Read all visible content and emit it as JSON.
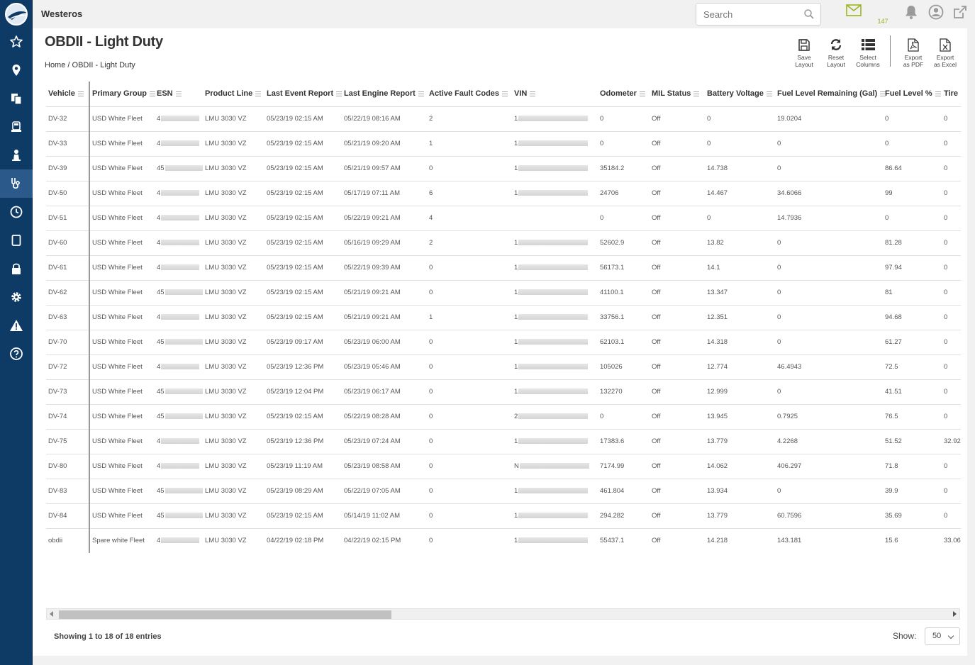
{
  "app": {
    "org_name": "Westeros",
    "search_placeholder": "Search",
    "mail_count": "147"
  },
  "page": {
    "title": "OBDII - Light Duty",
    "breadcrumb_home": "Home",
    "breadcrumb_sep": "/",
    "breadcrumb_current": "OBDII - Light Duty"
  },
  "toolbar": {
    "save_layout": [
      "Save",
      "Layout"
    ],
    "reset_layout": [
      "Reset",
      "Layout"
    ],
    "select_columns": [
      "Select",
      "Columns"
    ],
    "export_pdf": [
      "Export",
      "as PDF"
    ],
    "export_excel": [
      "Export",
      "as Excel"
    ]
  },
  "table": {
    "columns": [
      "Vehicle",
      "Primary Group",
      "ESN",
      "Product Line",
      "Last Event Report",
      "Last Engine Report",
      "Active Fault Codes",
      "VIN",
      "Odometer",
      "MIL Status",
      "Battery Voltage",
      "Fuel Level Remaining (Gal)",
      "Fuel Level %",
      "Tire"
    ],
    "rows": [
      {
        "vehicle": "DV-32",
        "group": "USD White Fleet",
        "esn": "4",
        "product": "LMU 3030 VZ",
        "last_event": "05/23/19 02:15 AM",
        "last_engine": "05/22/19 08:16 AM",
        "faults": "2",
        "vin": "1",
        "odometer": "0",
        "mil": "Off",
        "battery": "0",
        "fuel_gal": "19.0204",
        "fuel_pct": "0",
        "tire": "0"
      },
      {
        "vehicle": "DV-33",
        "group": "USD White Fleet",
        "esn": "4",
        "product": "LMU 3030 VZ",
        "last_event": "05/23/19 02:15 AM",
        "last_engine": "05/21/19 09:20 AM",
        "faults": "1",
        "vin": "1",
        "odometer": "0",
        "mil": "Off",
        "battery": "0",
        "fuel_gal": "0",
        "fuel_pct": "0",
        "tire": "0"
      },
      {
        "vehicle": "DV-39",
        "group": "USD White Fleet",
        "esn": "45",
        "product": "LMU 3030 VZ",
        "last_event": "05/23/19 02:15 AM",
        "last_engine": "05/21/19 09:57 AM",
        "faults": "0",
        "vin": "1",
        "odometer": "35184.2",
        "mil": "Off",
        "battery": "14.738",
        "fuel_gal": "0",
        "fuel_pct": "86.64",
        "tire": "0"
      },
      {
        "vehicle": "DV-50",
        "group": "USD White Fleet",
        "esn": "4",
        "product": "LMU 3030 VZ",
        "last_event": "05/23/19 02:15 AM",
        "last_engine": "05/17/19 07:11 AM",
        "faults": "6",
        "vin": "1",
        "odometer": "24706",
        "mil": "Off",
        "battery": "14.467",
        "fuel_gal": "34.6066",
        "fuel_pct": "99",
        "tire": "0"
      },
      {
        "vehicle": "DV-51",
        "group": "USD White Fleet",
        "esn": "4",
        "product": "LMU 3030 VZ",
        "last_event": "05/23/19 02:15 AM",
        "last_engine": "05/22/19 09:21 AM",
        "faults": "4",
        "vin": "",
        "odometer": "0",
        "mil": "Off",
        "battery": "0",
        "fuel_gal": "14.7936",
        "fuel_pct": "0",
        "tire": "0"
      },
      {
        "vehicle": "DV-60",
        "group": "USD White Fleet",
        "esn": "4",
        "product": "LMU 3030 VZ",
        "last_event": "05/23/19 02:15 AM",
        "last_engine": "05/16/19 09:29 AM",
        "faults": "2",
        "vin": "1",
        "odometer": "52602.9",
        "mil": "Off",
        "battery": "13.82",
        "fuel_gal": "0",
        "fuel_pct": "81.28",
        "tire": "0"
      },
      {
        "vehicle": "DV-61",
        "group": "USD White Fleet",
        "esn": "4",
        "product": "LMU 3030 VZ",
        "last_event": "05/23/19 02:15 AM",
        "last_engine": "05/22/19 09:39 AM",
        "faults": "0",
        "vin": "1",
        "odometer": "56173.1",
        "mil": "Off",
        "battery": "14.1",
        "fuel_gal": "0",
        "fuel_pct": "97.94",
        "tire": "0"
      },
      {
        "vehicle": "DV-62",
        "group": "USD White Fleet",
        "esn": "45",
        "product": "LMU 3030 VZ",
        "last_event": "05/23/19 02:15 AM",
        "last_engine": "05/21/19 09:21 AM",
        "faults": "0",
        "vin": "1",
        "odometer": "41100.1",
        "mil": "Off",
        "battery": "13.347",
        "fuel_gal": "0",
        "fuel_pct": "81",
        "tire": "0"
      },
      {
        "vehicle": "DV-63",
        "group": "USD White Fleet",
        "esn": "4",
        "product": "LMU 3030 VZ",
        "last_event": "05/23/19 02:15 AM",
        "last_engine": "05/21/19 09:21 AM",
        "faults": "1",
        "vin": "1",
        "odometer": "33756.1",
        "mil": "Off",
        "battery": "12.351",
        "fuel_gal": "0",
        "fuel_pct": "94.68",
        "tire": "0"
      },
      {
        "vehicle": "DV-70",
        "group": "USD White Fleet",
        "esn": "45",
        "product": "LMU 3030 VZ",
        "last_event": "05/23/19 09:17 AM",
        "last_engine": "05/23/19 06:00 AM",
        "faults": "0",
        "vin": "1",
        "odometer": "62103.1",
        "mil": "Off",
        "battery": "14.318",
        "fuel_gal": "0",
        "fuel_pct": "61.27",
        "tire": "0"
      },
      {
        "vehicle": "DV-72",
        "group": "USD White Fleet",
        "esn": "4",
        "product": "LMU 3030 VZ",
        "last_event": "05/23/19 12:36 PM",
        "last_engine": "05/23/19 05:46 AM",
        "faults": "0",
        "vin": "1",
        "odometer": "105026",
        "mil": "Off",
        "battery": "12.774",
        "fuel_gal": "46.4943",
        "fuel_pct": "72.5",
        "tire": "0"
      },
      {
        "vehicle": "DV-73",
        "group": "USD White Fleet",
        "esn": "45",
        "product": "LMU 3030 VZ",
        "last_event": "05/23/19 12:04 PM",
        "last_engine": "05/23/19 06:17 AM",
        "faults": "0",
        "vin": "1",
        "odometer": "132270",
        "mil": "Off",
        "battery": "12.999",
        "fuel_gal": "0",
        "fuel_pct": "41.51",
        "tire": "0"
      },
      {
        "vehicle": "DV-74",
        "group": "USD White Fleet",
        "esn": "45",
        "product": "LMU 3030 VZ",
        "last_event": "05/23/19 02:15 AM",
        "last_engine": "05/22/19 08:28 AM",
        "faults": "0",
        "vin": "2",
        "odometer": "0",
        "mil": "Off",
        "battery": "13.945",
        "fuel_gal": "0.7925",
        "fuel_pct": "76.5",
        "tire": "0"
      },
      {
        "vehicle": "DV-75",
        "group": "USD White Fleet",
        "esn": "4",
        "product": "LMU 3030 VZ",
        "last_event": "05/23/19 12:36 PM",
        "last_engine": "05/23/19 07:24 AM",
        "faults": "0",
        "vin": "1",
        "odometer": "17383.6",
        "mil": "Off",
        "battery": "13.779",
        "fuel_gal": "4.2268",
        "fuel_pct": "51.52",
        "tire": "32.92"
      },
      {
        "vehicle": "DV-80",
        "group": "USD White Fleet",
        "esn": "4",
        "product": "LMU 3030 VZ",
        "last_event": "05/23/19 11:19 AM",
        "last_engine": "05/23/19 08:58 AM",
        "faults": "0",
        "vin": "N",
        "odometer": "7174.99",
        "mil": "Off",
        "battery": "14.062",
        "fuel_gal": "406.297",
        "fuel_pct": "71.8",
        "tire": "0"
      },
      {
        "vehicle": "DV-83",
        "group": "USD White Fleet",
        "esn": "45",
        "product": "LMU 3030 VZ",
        "last_event": "05/23/19 08:29 AM",
        "last_engine": "05/22/19 07:05 AM",
        "faults": "0",
        "vin": "1",
        "odometer": "461.804",
        "mil": "Off",
        "battery": "13.934",
        "fuel_gal": "0",
        "fuel_pct": "39.9",
        "tire": "0"
      },
      {
        "vehicle": "DV-84",
        "group": "USD White Fleet",
        "esn": "45",
        "product": "LMU 3030 VZ",
        "last_event": "05/23/19 02:15 AM",
        "last_engine": "05/14/19 11:02 AM",
        "faults": "0",
        "vin": "1",
        "odometer": "294.282",
        "mil": "Off",
        "battery": "13.779",
        "fuel_gal": "60.7596",
        "fuel_pct": "35.69",
        "tire": "0"
      },
      {
        "vehicle": "obdii",
        "group": "Spare white Fleet",
        "esn": "4",
        "product": "LMU 3030 VZ",
        "last_event": "04/22/19 02:18 PM",
        "last_engine": "04/22/19 02:15 PM",
        "faults": "0",
        "vin": "1",
        "odometer": "55437.1",
        "mil": "Off",
        "battery": "14.218",
        "fuel_gal": "143.181",
        "fuel_pct": "15.6",
        "tire": "33.06"
      }
    ]
  },
  "footer": {
    "entries_text": "Showing 1 to 18 of 18 entries",
    "show_label": "Show:",
    "page_size": "50"
  },
  "colors": {
    "sidebar": "#0e3a66",
    "sidebar_active": "#2b5a8a",
    "mail_accent": "#9ab51e"
  },
  "icons": [
    "star-icon",
    "location-pin-icon",
    "documents-icon",
    "vehicle-icon",
    "driver-icon",
    "diagnostics-icon",
    "clock-icon",
    "tablet-icon",
    "lock-icon",
    "gear-icon",
    "alert-icon",
    "help-icon"
  ]
}
